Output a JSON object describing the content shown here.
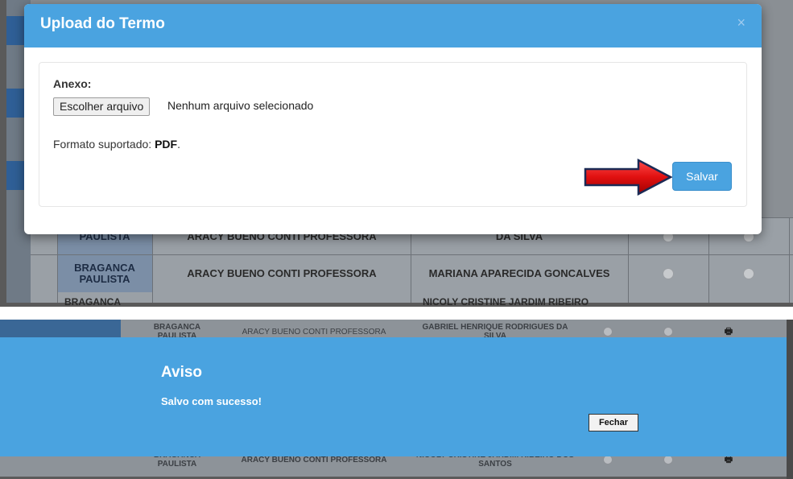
{
  "top": {
    "modal": {
      "title": "Upload do Termo",
      "close_glyph": "×",
      "anexo_label": "Anexo:",
      "file_button_label": "Escolher arquivo",
      "file_status": "Nenhum arquivo selecionado",
      "formato_prefix": "Formato suportado: ",
      "formato_value": "PDF",
      "formato_suffix": ".",
      "save_label": "Salvar"
    },
    "table_rows": [
      {
        "city": "PAULISTA",
        "school": "ARACY BUENO CONTI PROFESSORA",
        "student": "DA SILVA"
      },
      {
        "city": "BRAGANCA PAULISTA",
        "school": "ARACY BUENO CONTI PROFESSORA",
        "student": "MARIANA APARECIDA GONCALVES"
      }
    ],
    "partial_row": {
      "city": "BRAGANCA",
      "student": "NICOLY CRISTINE JARDIM RIBEIRO"
    }
  },
  "bottom": {
    "bg_rows": [
      {
        "city": "BRAGANCA PAULISTA",
        "school": "ARACY BUENO CONTI PROFESSORA",
        "student": "GABRIEL HENRIQUE RODRIGUES DA SILVA",
        "print_glyph": "🖶"
      },
      {
        "city": "BRAGANCA PAULISTA",
        "school": "ARACY BUENO CONTI PROFESSORA",
        "student": "NICOLY CRISTINE JARDIM RIBEIRO DOS SANTOS",
        "print_glyph": "🖶"
      }
    ],
    "aviso": {
      "title": "Aviso",
      "message": "Salvo com sucesso!",
      "close_label": "Fechar"
    }
  },
  "colors": {
    "accent": "#4aa3e0",
    "arrow": "#e01010"
  }
}
